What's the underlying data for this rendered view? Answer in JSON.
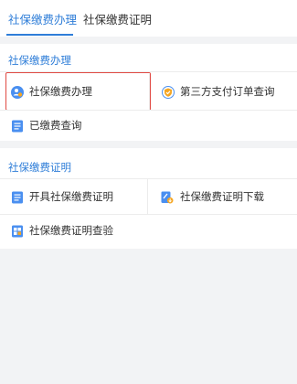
{
  "tabs": [
    {
      "label": "社保缴费办理",
      "active": true
    },
    {
      "label": "社保缴费证明",
      "active": false
    }
  ],
  "section1": {
    "title": "社保缴费办理",
    "items": [
      {
        "label": "社保缴费办理",
        "icon": "person-coin-icon",
        "highlighted": true
      },
      {
        "label": "第三方支付订单查询",
        "icon": "shield-check-icon"
      },
      {
        "label": "已缴费查询",
        "icon": "document-list-icon"
      }
    ]
  },
  "section2": {
    "title": "社保缴费证明",
    "items": [
      {
        "label": "开具社保缴费证明",
        "icon": "document-list-icon"
      },
      {
        "label": "社保缴费证明下载",
        "icon": "download-certificate-icon"
      },
      {
        "label": "社保缴费证明查验",
        "icon": "verify-certificate-icon"
      }
    ]
  },
  "colors": {
    "accent": "#2f7ed8",
    "highlight_border": "#e04a43",
    "icon_blue": "#4a8ff0",
    "icon_orange": "#f5a623"
  }
}
